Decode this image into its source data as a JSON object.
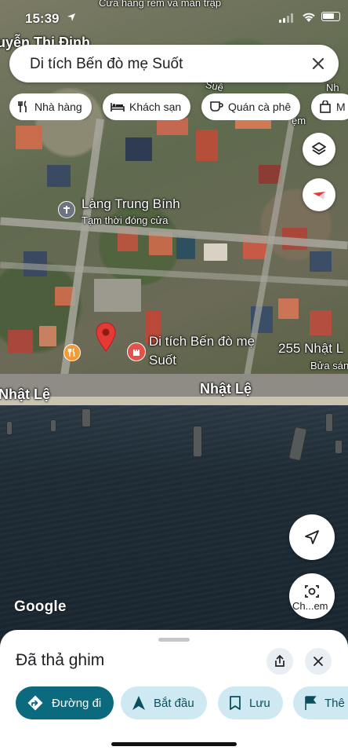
{
  "status_bar": {
    "time": "15:39",
    "location_label": "Cửa hàng rèm và màn trập"
  },
  "search": {
    "query": "Di tích Bến đò mẹ Suốt"
  },
  "chips": [
    {
      "icon": "restaurant-icon",
      "label": "Nhà hàng"
    },
    {
      "icon": "hotel-icon",
      "label": "Khách sạn"
    },
    {
      "icon": "coffee-icon",
      "label": "Quán cà phê"
    },
    {
      "icon": "shopping-bag-icon",
      "label": "M"
    }
  ],
  "map": {
    "labels": {
      "street_top": "uyễn Thị Định",
      "place_village": "Làng Trung Bính",
      "place_village_status": "Tạm thời đóng cửa",
      "place_landmark_line1": "Di tích Bến đò mẹ",
      "place_landmark_line2": "Suốt",
      "address_right": "255 Nhật L",
      "address_right_sub": "Bửa sán",
      "road_left": "Nhật Lệ",
      "road_center": "Nhật Lệ",
      "top_right_partial": "Nh",
      "top_right_road": "Suê",
      "top_right_road2": "ệm"
    },
    "attribution": "Google",
    "directions_fab_label": "Ch...em",
    "accent_pin_color": "#e53935",
    "landmark_badge_color": "#e0524a",
    "restaurant_badge_color": "#f29b34"
  },
  "sheet": {
    "title": "Đã thả ghim",
    "actions": [
      {
        "icon": "directions-icon",
        "label": "Đường đi",
        "style": "primary"
      },
      {
        "icon": "navigation-arrow-icon",
        "label": "Bắt đầu",
        "style": "secondary"
      },
      {
        "icon": "bookmark-icon",
        "label": "Lưu",
        "style": "secondary"
      },
      {
        "icon": "flag-icon",
        "label": "Thê",
        "style": "secondary"
      }
    ]
  }
}
